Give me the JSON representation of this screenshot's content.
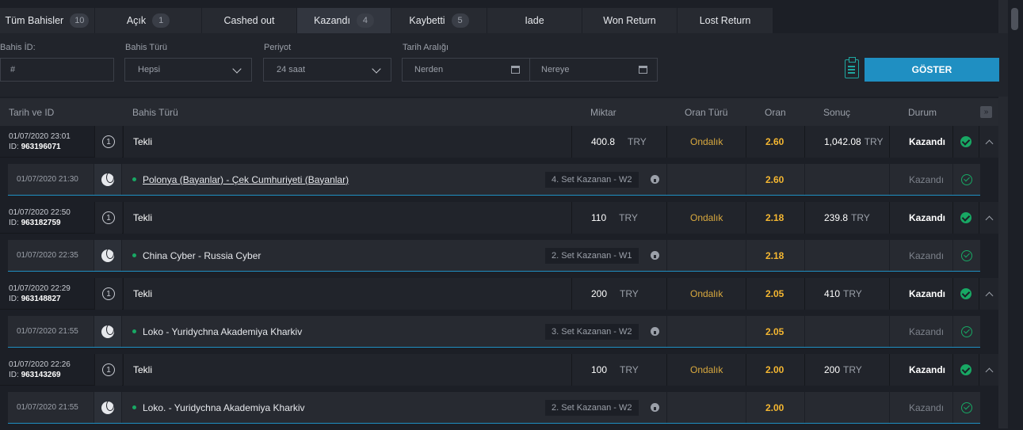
{
  "tabs": [
    {
      "label": "Tüm Bahisler",
      "count": "10",
      "w": 120
    },
    {
      "label": "Açık",
      "count": "1",
      "w": 135
    },
    {
      "label": "Cashed out",
      "count": "",
      "w": 120
    },
    {
      "label": "Kazandı",
      "count": "4",
      "w": 119
    },
    {
      "label": "Kaybetti",
      "count": "5",
      "w": 121
    },
    {
      "label": "Iade",
      "count": "",
      "w": 120
    },
    {
      "label": "Won Return",
      "count": "",
      "w": 120
    },
    {
      "label": "Lost Return",
      "count": "",
      "w": 121
    }
  ],
  "filters": {
    "bet_id_label": "Bahis İD:",
    "bet_id_placeholder": "#",
    "bet_type_label": "Bahis Türü",
    "bet_type_value": "Hepsi",
    "period_label": "Periyot",
    "period_value": "24 saat",
    "date_range_label": "Tarih Aralığı",
    "from_placeholder": "Nerden",
    "to_placeholder": "Nereye",
    "show_button": "GÖSTER"
  },
  "table_header": {
    "date_id": "Tarih ve ID",
    "bet_type": "Bahis Türü",
    "amount": "Miktar",
    "odds_type": "Oran Türü",
    "odds": "Oran",
    "result": "Sonuç",
    "status": "Durum",
    "toggle": "»"
  },
  "bets": [
    {
      "date": "01/07/2020 23:01",
      "id_label": "ID:",
      "id": "963196071",
      "num": "1",
      "type": "Tekli",
      "amount": "400.8",
      "currency": "TRY",
      "odds_type": "Ondalık",
      "odds": "2.60",
      "result": "1,042.08",
      "result_currency": "TRY",
      "status": "Kazandı",
      "selection": {
        "date": "01/07/2020 21:30",
        "match": "Polonya (Bayanlar) - Çek Cumhuriyeti (Bayanlar)",
        "market": "4. Set Kazanan - W2",
        "odds": "2.60",
        "status": "Kazandı"
      }
    },
    {
      "date": "01/07/2020 22:50",
      "id_label": "ID:",
      "id": "963182759",
      "num": "1",
      "type": "Tekli",
      "amount": "110",
      "currency": "TRY",
      "odds_type": "Ondalık",
      "odds": "2.18",
      "result": "239.8",
      "result_currency": "TRY",
      "status": "Kazandı",
      "selection": {
        "date": "01/07/2020 22:35",
        "match": "China Cyber - Russia Cyber",
        "market": "2. Set Kazanan - W1",
        "odds": "2.18",
        "status": "Kazandı"
      }
    },
    {
      "date": "01/07/2020 22:29",
      "id_label": "ID:",
      "id": "963148827",
      "num": "1",
      "type": "Tekli",
      "amount": "200",
      "currency": "TRY",
      "odds_type": "Ondalık",
      "odds": "2.05",
      "result": "410",
      "result_currency": "TRY",
      "status": "Kazandı",
      "selection": {
        "date": "01/07/2020 21:55",
        "match": "Loko - Yuridychna Akademiya Kharkiv",
        "market": "3. Set Kazanan - W2",
        "odds": "2.05",
        "status": "Kazandı"
      }
    },
    {
      "date": "01/07/2020 22:26",
      "id_label": "ID:",
      "id": "963143269",
      "num": "1",
      "type": "Tekli",
      "amount": "100",
      "currency": "TRY",
      "odds_type": "Ondalık",
      "odds": "2.00",
      "result": "200",
      "result_currency": "TRY",
      "status": "Kazandı",
      "selection": {
        "date": "01/07/2020 21:55",
        "match": "Loko. - Yuridychna Akademiya Kharkiv",
        "market": "2. Set Kazanan - W2",
        "odds": "2.00",
        "status": "Kazandı"
      }
    }
  ],
  "colors": {
    "accent": "#1f8fc2",
    "odds": "#f5b731",
    "odds_type": "#d9a93f",
    "win": "#18a864"
  }
}
